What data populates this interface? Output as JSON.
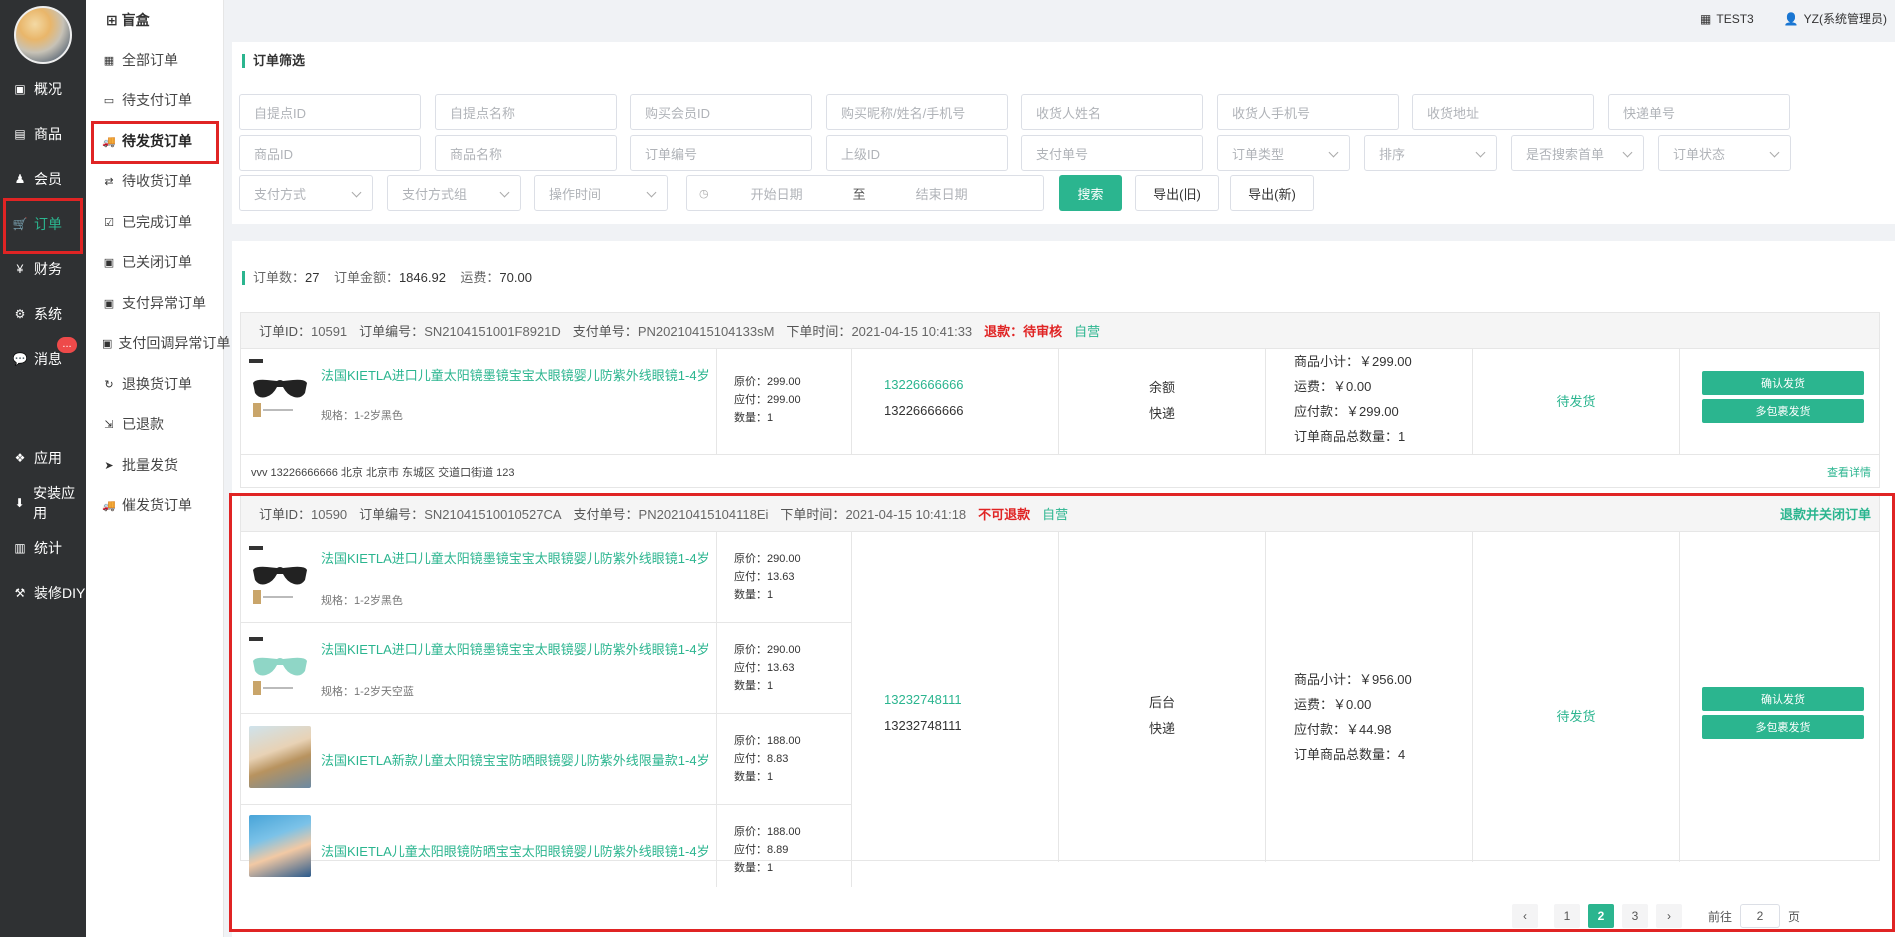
{
  "header": {
    "title": "盲盒",
    "workspace": "TEST3",
    "user": "YZ(系统管理员)"
  },
  "sidebar": {
    "items": [
      {
        "label": "概况",
        "icon": "dashboard-icon",
        "glyph": "▣"
      },
      {
        "label": "商品",
        "icon": "goods-icon",
        "glyph": "▤"
      },
      {
        "label": "会员",
        "icon": "members-icon",
        "glyph": "♟"
      },
      {
        "label": "订单",
        "icon": "cart-icon",
        "glyph": "🛒"
      },
      {
        "label": "财务",
        "icon": "yen-icon",
        "glyph": "¥"
      },
      {
        "label": "系统",
        "icon": "cogs-icon",
        "glyph": "⚙"
      },
      {
        "label": "消息",
        "icon": "chat-icon",
        "glyph": "💬"
      },
      {
        "label": "应用",
        "icon": "apps-icon",
        "glyph": "❖"
      },
      {
        "label": "安装应用",
        "icon": "install-icon",
        "glyph": "⬇"
      },
      {
        "label": "统计",
        "icon": "bar-chart-icon",
        "glyph": "▥"
      },
      {
        "label": "装修DIY",
        "icon": "hammer-icon",
        "glyph": "⚒"
      }
    ],
    "message_badge": "..."
  },
  "subnav": {
    "items": [
      {
        "label": "全部订单",
        "glyph": "▦"
      },
      {
        "label": "待支付订单",
        "glyph": "▭"
      },
      {
        "label": "待发货订单",
        "glyph": "🚚"
      },
      {
        "label": "待收货订单",
        "glyph": "⇄"
      },
      {
        "label": "已完成订单",
        "glyph": "☑"
      },
      {
        "label": "已关闭订单",
        "glyph": "▣"
      },
      {
        "label": "支付异常订单",
        "glyph": "▣"
      },
      {
        "label": "支付回调异常订单",
        "glyph": "▣"
      },
      {
        "label": "退换货订单",
        "glyph": "↻"
      },
      {
        "label": "已退款",
        "glyph": "⇲"
      },
      {
        "label": "批量发货",
        "glyph": "➤"
      },
      {
        "label": "催发货订单",
        "glyph": "🚚"
      }
    ]
  },
  "filter": {
    "title": "订单筛选",
    "row1": [
      "自提点ID",
      "自提点名称",
      "购买会员ID",
      "购买昵称/姓名/手机号",
      "收货人姓名",
      "收货人手机号",
      "收货地址",
      "快递单号"
    ],
    "row2_inputs": [
      "商品ID",
      "商品名称",
      "订单编号",
      "上级ID",
      "支付单号"
    ],
    "row2_selects": [
      "订单类型",
      "排序",
      "是否搜索首单",
      "订单状态"
    ],
    "row3_selects": [
      "支付方式",
      "支付方式组",
      "操作时间"
    ],
    "date_start": "开始日期",
    "date_sep": "至",
    "date_end": "结束日期",
    "search": "搜索",
    "export_old": "导出(旧)",
    "export_new": "导出(新)"
  },
  "summary": {
    "count_label": "订单数：",
    "count": "27",
    "amount_label": "订单金额：",
    "amount": "1846.92",
    "freight_label": "运费：",
    "freight": "70.00"
  },
  "orders": [
    {
      "id_label": "订单ID：",
      "id": "10591",
      "no_label": "订单编号：",
      "no": "SN2104151001F8921D",
      "pay_label": "支付单号：",
      "pay_no": "PN20210415104133sM",
      "time_label": "下单时间：",
      "time": "2021-04-15 10:41:33",
      "refund": "退款：待审核",
      "tag": "自营",
      "products": [
        {
          "name": "法国KIETLA进口儿童太阳镜墨镜宝宝太眼镜婴儿防紫外线眼镜1-4岁",
          "spec": "规格：1-2岁黑色",
          "orig_label": "原价：",
          "orig": "299.00",
          "pay_label": "应付：",
          "pay": "299.00",
          "qty_label": "数量：",
          "qty": "1"
        }
      ],
      "phone1": "13226666666",
      "phone2": "13226666666",
      "pay_method": "余额",
      "ship_method": "快递",
      "subtotal": "商品小计：￥299.00",
      "freight": "运费：￥0.00",
      "payable": "应付款：￥299.00",
      "total_qty": "订单商品总数量：1",
      "status": "待发货",
      "btn_ship": "确认发货",
      "btn_multi": "多包裹发货",
      "address": "vvv   13226666666   北京 北京市 东城区 交道口街道 123",
      "detail_link": "查看详情"
    },
    {
      "id_label": "订单ID：",
      "id": "10590",
      "no_label": "订单编号：",
      "no": "SN21041510010527CA",
      "pay_label": "支付单号：",
      "pay_no": "PN20210415104118Ei",
      "time_label": "下单时间：",
      "time": "2021-04-15 10:41:18",
      "refund": "不可退款",
      "tag": "自营",
      "close_link": "退款并关闭订单",
      "products": [
        {
          "name": "法国KIETLA进口儿童太阳镜墨镜宝宝太眼镜婴儿防紫外线眼镜1-4岁",
          "spec": "规格：1-2岁黑色",
          "orig_label": "原价：",
          "orig": "290.00",
          "pay_label": "应付：",
          "pay": "13.63",
          "qty_label": "数量：",
          "qty": "1"
        },
        {
          "name": "法国KIETLA进口儿童太阳镜墨镜宝宝太眼镜婴儿防紫外线眼镜1-4岁",
          "spec": "规格：1-2岁天空蓝",
          "orig_label": "原价：",
          "orig": "290.00",
          "pay_label": "应付：",
          "pay": "13.63",
          "qty_label": "数量：",
          "qty": "1"
        },
        {
          "name": "法国KIETLA新款儿童太阳镜宝宝防晒眼镜婴儿防紫外线限量款1-4岁",
          "spec": "",
          "orig_label": "原价：",
          "orig": "188.00",
          "pay_label": "应付：",
          "pay": "8.83",
          "qty_label": "数量：",
          "qty": "1"
        },
        {
          "name": "法国KIETLA儿童太阳眼镜防晒宝宝太阳眼镜婴儿防紫外线眼镜1-4岁",
          "spec": "",
          "orig_label": "原价：",
          "orig": "188.00",
          "pay_label": "应付：",
          "pay": "8.89",
          "qty_label": "数量：",
          "qty": "1"
        }
      ],
      "phone1": "13232748111",
      "phone2": "13232748111",
      "pay_method": "后台",
      "ship_method": "快递",
      "subtotal": "商品小计：￥956.00",
      "freight": "运费：￥0.00",
      "payable": "应付款：￥44.98",
      "total_qty": "订单商品总数量：4",
      "status": "待发货",
      "btn_ship": "确认发货",
      "btn_multi": "多包裹发货"
    }
  ],
  "pagination": {
    "prev": "‹",
    "next": "›",
    "pages": [
      "1",
      "2",
      "3"
    ],
    "current": "2",
    "goto_label": "前往",
    "goto_value": "2",
    "page_suffix": "页"
  },
  "colors": {
    "accent": "#2bb58f",
    "danger": "#e02424",
    "sidebar": "#2f3133"
  }
}
